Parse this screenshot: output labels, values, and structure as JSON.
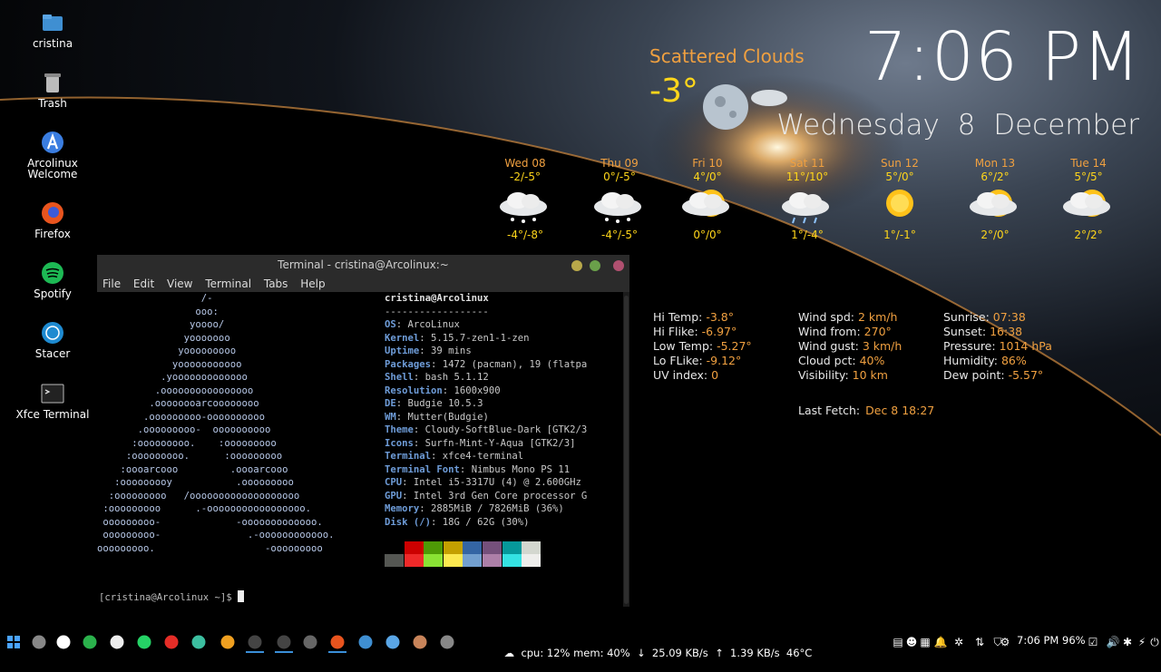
{
  "desktop": {
    "icons": [
      {
        "label": "cristina",
        "icon": "folder-home-icon"
      },
      {
        "label": "Trash",
        "icon": "trash-icon"
      },
      {
        "label": "Arcolinux Welcome",
        "icon": "arcolinux-icon"
      },
      {
        "label": "Firefox",
        "icon": "firefox-icon"
      },
      {
        "label": "Spotify",
        "icon": "spotify-icon"
      },
      {
        "label": "Stacer",
        "icon": "stacer-icon"
      },
      {
        "label": "Xfce Terminal",
        "icon": "terminal-icon"
      }
    ]
  },
  "clock": {
    "time": "7:06 PM",
    "date": "Wednesday  8 December"
  },
  "weather": {
    "condition": "Scattered Clouds",
    "temp": "-3°",
    "forecast": [
      {
        "day": "Wed 08",
        "hi": "-2/-5°",
        "lo": "-4°/-8°",
        "icon": "snow-cloud-icon"
      },
      {
        "day": "Thu 09",
        "hi": "0°/-5°",
        "lo": "-4°/-5°",
        "icon": "snow-cloud-icon"
      },
      {
        "day": "Fri 10",
        "hi": "4°/0°",
        "lo": "0°/0°",
        "icon": "cloud-sun-icon"
      },
      {
        "day": "Sat 11",
        "hi": "11°/10°",
        "lo": "1°/-4°",
        "icon": "rain-cloud-icon"
      },
      {
        "day": "Sun 12",
        "hi": "5°/0°",
        "lo": "1°/-1°",
        "icon": "sun-icon"
      },
      {
        "day": "Mon 13",
        "hi": "6°/2°",
        "lo": "2°/0°",
        "icon": "sun-cloud-icon"
      },
      {
        "day": "Tue 14",
        "hi": "5°/5°",
        "lo": "2°/2°",
        "icon": "sun-cloud-icon"
      }
    ],
    "stats": [
      [
        {
          "k": "Hi Temp:",
          "v": "-3.8°"
        },
        {
          "k": "Hi Flike:",
          "v": "-6.97°"
        },
        {
          "k": "Low Temp:",
          "v": "-5.27°"
        },
        {
          "k": "Lo FLike:",
          "v": "-9.12°"
        },
        {
          "k": "UV index:",
          "v": "0"
        }
      ],
      [
        {
          "k": "Wind spd:",
          "v": "2 km/h"
        },
        {
          "k": "Wind from:",
          "v": "270°"
        },
        {
          "k": "Wind gust:",
          "v": "3 km/h"
        },
        {
          "k": "Cloud pct:",
          "v": "40%"
        },
        {
          "k": "Visibility:",
          "v": "10 km"
        }
      ],
      [
        {
          "k": "Sunrise:",
          "v": "07:38"
        },
        {
          "k": "Sunset:",
          "v": "16:38"
        },
        {
          "k": "Pressure:",
          "v": "1014 hPa"
        },
        {
          "k": "Humidity:",
          "v": "86%"
        },
        {
          "k": "Dew point:",
          "v": "-5.57°"
        }
      ]
    ],
    "last_fetch_label": "Last Fetch:",
    "last_fetch_value": "Dec  8 18:27"
  },
  "terminal": {
    "title": "Terminal - cristina@Arcolinux:~",
    "menu": [
      "File",
      "Edit",
      "View",
      "Terminal",
      "Tabs",
      "Help"
    ],
    "ascii": [
      "                  /-",
      "                 ooo:",
      "                yoooo/",
      "               yooooooo",
      "              yooooooooo",
      "             yooooooooooo",
      "           .yooooooooooooo",
      "          .oooooooooooooooo",
      "         .oooooooarcoooooooo",
      "        .ooooooooo-oooooooooo",
      "       .ooooooooo-  oooooooooo",
      "      :ooooooooo.    :ooooooooo",
      "     :ooooooooo.      :ooooooooo",
      "    :oooarcooo         .oooarcooo",
      "   :ooooooooy           .ooooooooo",
      "  :ooooooooo   /ooooooooooooooooooo",
      " :ooooooooo      .-ooooooooooooooooo.",
      " ooooooooo-             -ooooooooooooo.",
      " ooooooooo-               .-oooooooooooo.",
      "ooooooooo.                   -ooooooooo"
    ],
    "user_host": "cristina@Arcolinux",
    "separator": "------------------",
    "info": [
      {
        "k": "OS",
        "v": "ArcoLinux"
      },
      {
        "k": "Kernel",
        "v": "5.15.7-zen1-1-zen"
      },
      {
        "k": "Uptime",
        "v": "39 mins"
      },
      {
        "k": "Packages",
        "v": "1472 (pacman), 19 (flatpa"
      },
      {
        "k": "Shell",
        "v": "bash 5.1.12"
      },
      {
        "k": "Resolution",
        "v": "1600x900"
      },
      {
        "k": "DE",
        "v": "Budgie 10.5.3"
      },
      {
        "k": "WM",
        "v": "Mutter(Budgie)"
      },
      {
        "k": "Theme",
        "v": "Cloudy-SoftBlue-Dark [GTK2/3"
      },
      {
        "k": "Icons",
        "v": "Surfn-Mint-Y-Aqua [GTK2/3]"
      },
      {
        "k": "Terminal",
        "v": "xfce4-terminal"
      },
      {
        "k": "Terminal Font",
        "v": "Nimbus Mono PS 11"
      },
      {
        "k": "CPU",
        "v": "Intel i5-3317U (4) @ 2.600GHz"
      },
      {
        "k": "GPU",
        "v": "Intel 3rd Gen Core processor G"
      },
      {
        "k": "Memory",
        "v": "2885MiB / 7826MiB (36%)"
      },
      {
        "k": "Disk (/)",
        "v": "18G / 62G (30%)"
      }
    ],
    "palette_top": [
      "#000000",
      "#cc0000",
      "#4e9a06",
      "#c4a000",
      "#3465a4",
      "#75507b",
      "#06989a",
      "#d3d7cf"
    ],
    "palette_bottom": [
      "#555753",
      "#ef2929",
      "#8ae234",
      "#fce94f",
      "#729fcf",
      "#ad7fa8",
      "#34e2e2",
      "#eeeeec"
    ],
    "prompt": "[cristina@Arcolinux ~]$ "
  },
  "taskbar": {
    "apps": [
      "menu-grid-icon",
      "files-icon",
      "arcolinux-a-icon",
      "gnome-calendar-icon",
      "play-icon",
      "whatsapp-icon",
      "youtube-icon",
      "screen-icon",
      "brave-icon",
      "terminal-icon",
      "terminal2-icon",
      "tweak-icon",
      "firefox-icon",
      "folder-icon",
      "folder2-icon",
      "clipboard-icon",
      "mixer-icon"
    ],
    "sys_text": "cpu: 12% mem: 40%  ↓  25.09 KB/s  ↑  1.39 KB/s  46°C",
    "time": "7:06 PM",
    "battery": "96%"
  }
}
